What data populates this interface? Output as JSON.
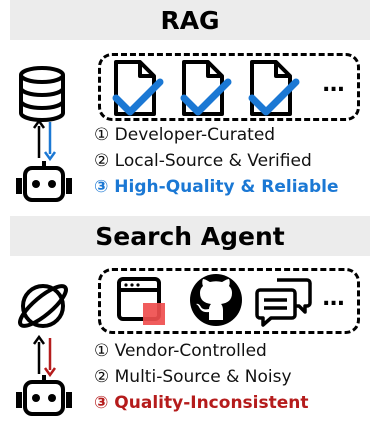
{
  "rag": {
    "title": "RAG",
    "ellipsis": "...",
    "lines": [
      "① Developer-Curated",
      "② Local-Source & Verified",
      "③ High-Quality & Reliable"
    ],
    "highlight_color": "#1b78d4"
  },
  "search": {
    "title": "Search Agent",
    "ellipsis": "...",
    "lines": [
      "① Vendor-Controlled",
      "② Multi-Source & Noisy",
      "③ Quality-Inconsistent"
    ],
    "highlight_color": "#b51c1c"
  },
  "colors": {
    "header_bg": "#ececec",
    "check": "#1b78d4",
    "arrow_blue": "#1b78d4",
    "arrow_red": "#b51c1c",
    "red_square": "#ef4e4e"
  }
}
